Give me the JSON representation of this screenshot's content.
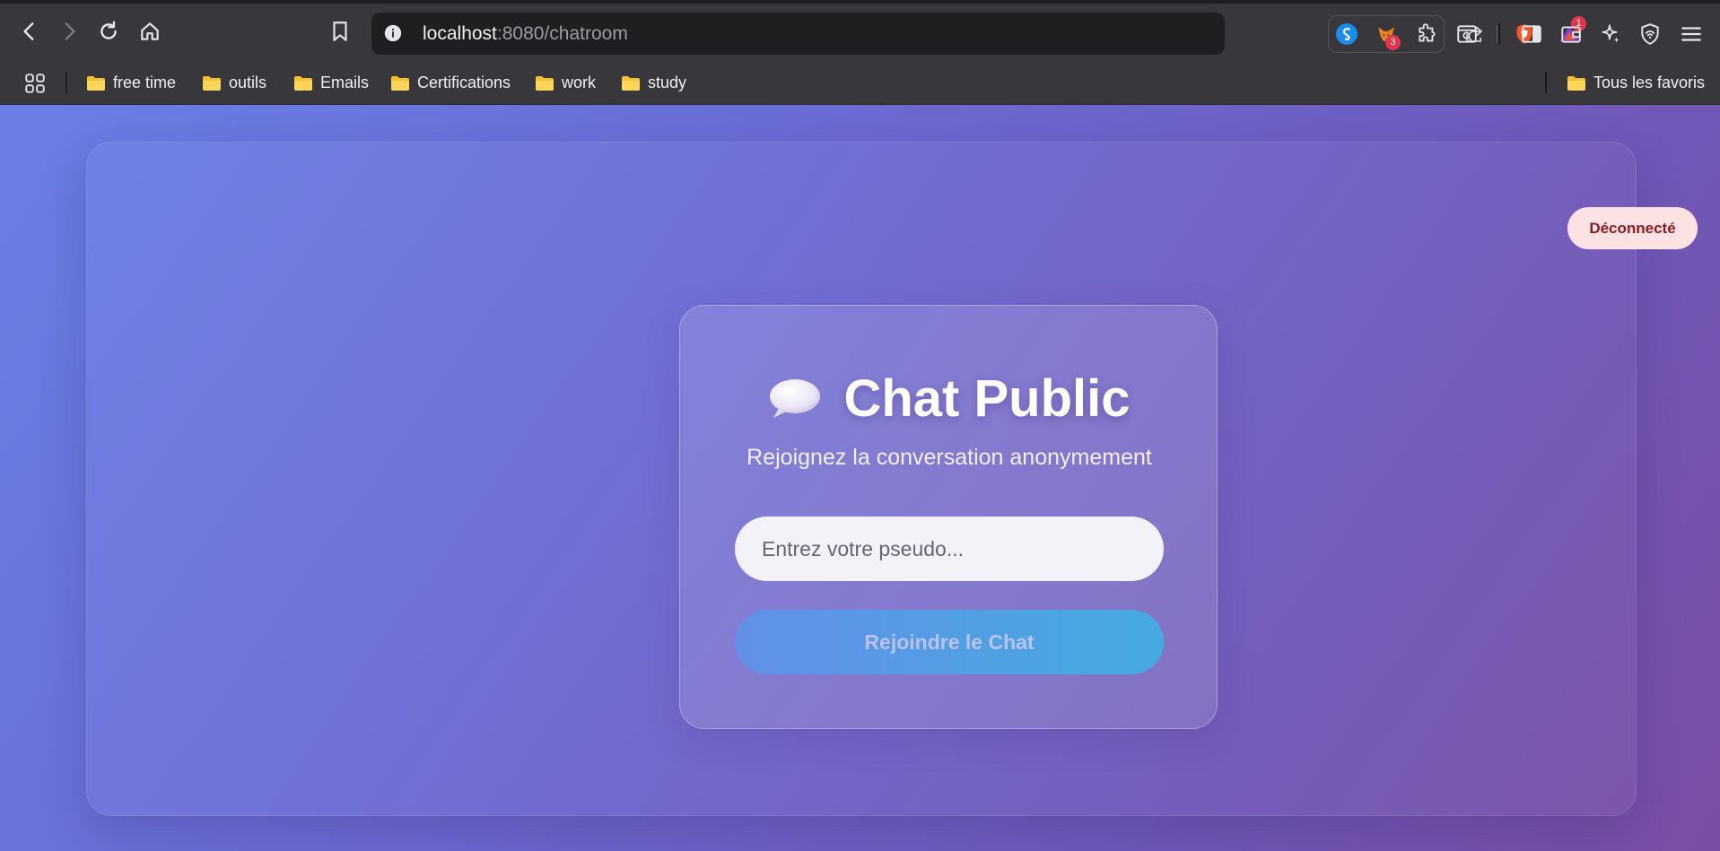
{
  "browser": {
    "url_host": "localhost",
    "url_path": ":8080/chatroom",
    "brave_rewards_badge": "1",
    "extension_badge": "3"
  },
  "bookmarks": {
    "items": [
      {
        "label": "free time"
      },
      {
        "label": "outils"
      },
      {
        "label": "Emails"
      },
      {
        "label": "Certifications"
      },
      {
        "label": "work"
      },
      {
        "label": "study"
      }
    ],
    "all_bookmarks_label": "Tous les favoris"
  },
  "app": {
    "status_label": "Déconnecté",
    "title": "Chat Public",
    "subtitle": "Rejoignez la conversation anonymement",
    "pseudo_placeholder": "Entrez votre pseudo...",
    "join_button_label": "Rejoindre le Chat"
  },
  "colors": {
    "status_bg": "#fde2e4",
    "status_text": "#8a1c25",
    "button_gradient_start": "#6290e6",
    "button_gradient_end": "#44abe0",
    "page_gradient_start": "#6a7fe6",
    "page_gradient_end": "#7a4ea6"
  }
}
